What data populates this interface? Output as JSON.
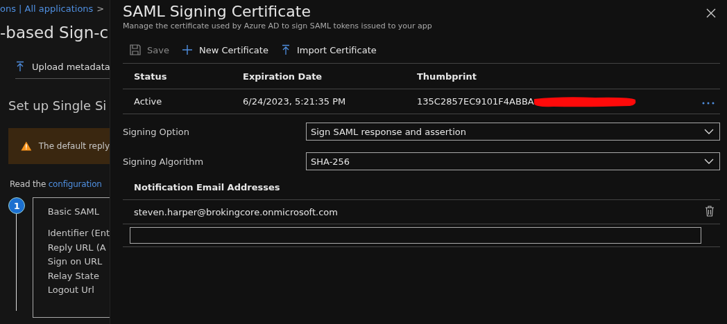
{
  "background_page": {
    "breadcrumb": "ons | All applications",
    "breadcrumb_separator": ">",
    "title": "-based Sign-c",
    "toolbar": [
      "Upload metadata"
    ],
    "section_title": "Set up Single Si",
    "warning": "The default reply",
    "read_prefix": "Read the",
    "read_link": "configuration",
    "step": {
      "number": "1",
      "title": "Basic SAML",
      "fields": [
        "Identifier (Ent",
        "Reply URL (A",
        "Sign on URL",
        "Relay State",
        "Logout Url"
      ]
    }
  },
  "panel": {
    "title": "SAML Signing Certificate",
    "subtitle": "Manage the certificate used by Azure AD to sign SAML tokens issued to your app",
    "toolbar": [
      {
        "kind": "save",
        "label": "Save",
        "disabled": true
      },
      {
        "kind": "new",
        "label": "New Certificate",
        "disabled": false
      },
      {
        "kind": "import",
        "label": "Import Certificate",
        "disabled": false
      }
    ],
    "table": {
      "columns": [
        "Status",
        "Expiration Date",
        "Thumbprint"
      ],
      "rows": [
        {
          "status": "Active",
          "expiration": "6/24/2023, 5:21:35 PM",
          "thumbprint": "135C2857EC9101F4ABBA",
          "redacted": true
        }
      ]
    },
    "settings": [
      {
        "label": "Signing Option",
        "value": "Sign SAML response and assertion"
      },
      {
        "label": "Signing Algorithm",
        "value": "SHA-256"
      }
    ],
    "notification": {
      "heading": "Notification Email Addresses",
      "emails": [
        "steven.harper@brokingcore.onmicrosoft.com"
      ]
    }
  }
}
